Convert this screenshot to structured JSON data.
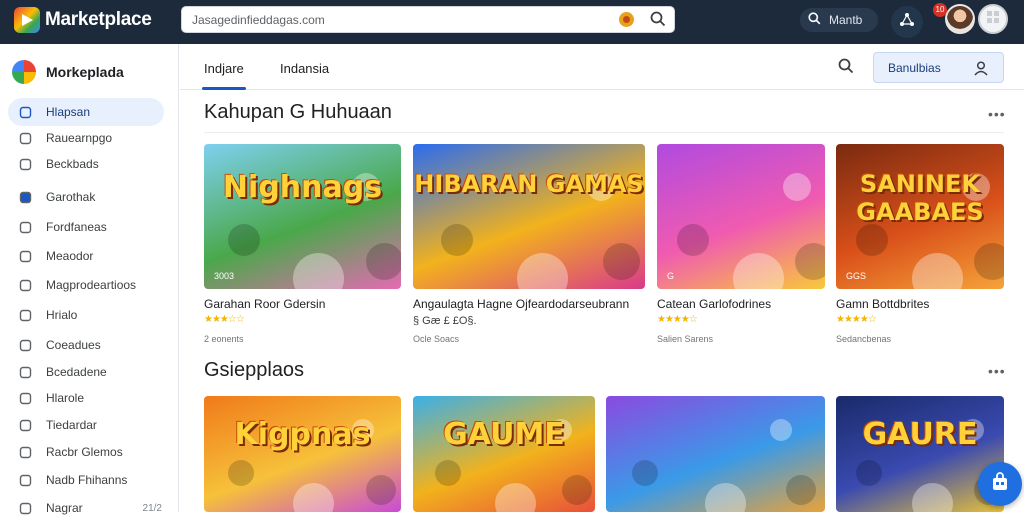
{
  "app": {
    "title": "Marketplace",
    "sidebar_title": "Morkeplada"
  },
  "search": {
    "value": "Jasagedinfieddagas.com",
    "top_button_label": "Mantb"
  },
  "notifications": {
    "count": "10"
  },
  "sidebar": {
    "items": [
      {
        "label": "Hlapsan",
        "icon": "google-g-icon",
        "active": true
      },
      {
        "label": "Rauearnpgo",
        "icon": "clock-icon"
      },
      {
        "label": "Beckbads",
        "icon": "tag-icon"
      },
      {
        "label": "Garothak",
        "icon": "app-icon"
      },
      {
        "label": "Fordfaneas",
        "icon": "card-icon"
      },
      {
        "label": "Meaodor",
        "icon": "gear-icon"
      },
      {
        "label": "Magprodeartioos",
        "icon": "compass-icon"
      },
      {
        "label": "Hrialo",
        "icon": "video-icon"
      },
      {
        "label": "Coeadues",
        "icon": "gamepad-icon"
      },
      {
        "label": "Bcedadene",
        "icon": "grid-icon"
      },
      {
        "label": "Hlarole",
        "icon": "book-icon"
      },
      {
        "label": "Tiedardar",
        "icon": "calendar-icon"
      },
      {
        "label": "Racbr Glemos",
        "icon": "people-icon"
      },
      {
        "label": "Nadb Fhihanns",
        "icon": "globe-icon"
      },
      {
        "label": "Nagrar",
        "icon": "flag-icon",
        "count": "21/2"
      }
    ]
  },
  "tabs": [
    {
      "label": "Indjare",
      "active": true
    },
    {
      "label": "Indansia",
      "active": false
    }
  ],
  "category_button": {
    "label": "Banulbias"
  },
  "sections": [
    {
      "title": "Kahupan G Huhuaan",
      "cards": [
        {
          "art_text": "Nighnags",
          "corner_tag": "3003",
          "title": "Garahan Roor Gdersin",
          "stars": "★★★☆☆",
          "meta": "2 eonents",
          "palette": [
            "#7ed0f0",
            "#4aa84a",
            "#e56ab3"
          ]
        },
        {
          "art_text": "HIBARAN GAMAS",
          "corner_tag": "",
          "title": "Angaulagta Hagne Ojfeardodarseubrann",
          "stars": "",
          "meta": "Ocle Soacs",
          "rating_text": "§ Gæ £ £O§.",
          "palette": [
            "#2a6cf0",
            "#f2b21c",
            "#d93a8a"
          ]
        },
        {
          "art_text": "",
          "corner_tag": "G",
          "title": "Catean Garlofodrines",
          "stars": "★★★★☆",
          "meta": "Salien Sarens",
          "palette": [
            "#b04ae0",
            "#f05bb0",
            "#f8c93a"
          ]
        },
        {
          "art_text": "SANINEK GAABAES",
          "corner_tag": "GGS",
          "title": "Gamn Bottdbrites",
          "stars": "★★★★☆",
          "meta": "Sedancbenas",
          "palette": [
            "#7a2a10",
            "#d9501a",
            "#f6a33a"
          ]
        }
      ]
    },
    {
      "title": "Gsiepplaos",
      "cards": [
        {
          "art_text": "Kigpnas",
          "palette": [
            "#f07a1a",
            "#f6c13a",
            "#c94ad6"
          ]
        },
        {
          "art_text": "GAUME",
          "palette": [
            "#3ab0e8",
            "#f2b21c",
            "#e8503a"
          ]
        },
        {
          "art_text": "",
          "palette": [
            "#8a4ae0",
            "#3a9ae8",
            "#e8a23a"
          ]
        },
        {
          "art_text": "GAURE",
          "palette": [
            "#1a2a6a",
            "#3a4ab0",
            "#e8c23a"
          ]
        }
      ]
    }
  ],
  "colors": {
    "topbar": "#1c2a3b",
    "accent": "#1a56c4",
    "fab": "#1f6fe0"
  }
}
